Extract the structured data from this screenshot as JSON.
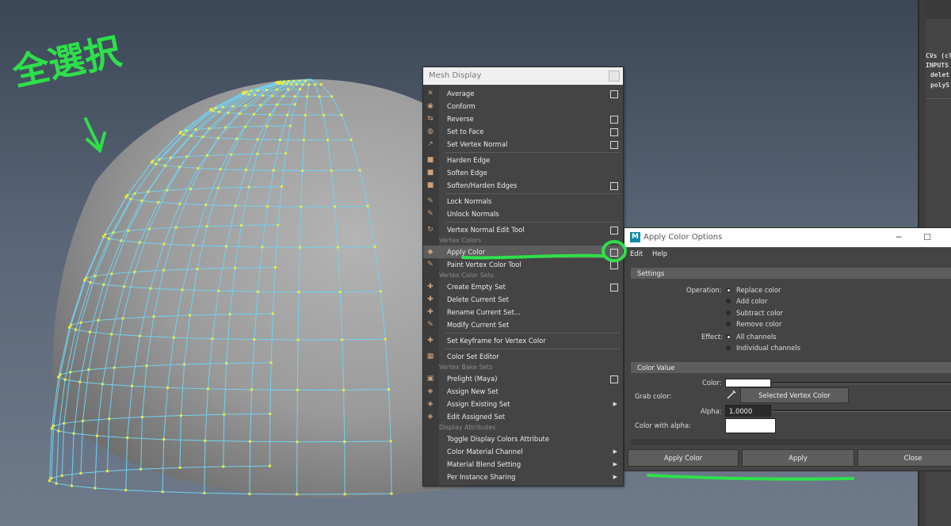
{
  "annotations": {
    "handwriting": "全選択"
  },
  "channel_box": {
    "lines": [
      "CVs (cl",
      "INPUTS",
      "delet",
      "polyS"
    ]
  },
  "mesh_display": {
    "title": "Mesh Display",
    "items": [
      {
        "type": "item",
        "label": "Average",
        "icon": "average-icon",
        "option": true
      },
      {
        "type": "item",
        "label": "Conform",
        "icon": "conform-icon",
        "option": false
      },
      {
        "type": "item",
        "label": "Reverse",
        "icon": "reverse-icon",
        "option": true
      },
      {
        "type": "item",
        "label": "Set to Face",
        "icon": "set-to-face-icon",
        "option": true
      },
      {
        "type": "item",
        "label": "Set Vertex Normal",
        "icon": "vertex-normal-icon",
        "option": true
      },
      {
        "type": "divider"
      },
      {
        "type": "item",
        "label": "Harden Edge",
        "icon": "harden-edge-icon",
        "option": false
      },
      {
        "type": "item",
        "label": "Soften Edge",
        "icon": "soften-edge-icon",
        "option": false
      },
      {
        "type": "item",
        "label": "Soften/Harden Edges",
        "icon": "soften-harden-icon",
        "option": true
      },
      {
        "type": "divider"
      },
      {
        "type": "item",
        "label": "Lock Normals",
        "icon": "lock-normals-icon",
        "option": false
      },
      {
        "type": "item",
        "label": "Unlock Normals",
        "icon": "unlock-normals-icon",
        "option": false
      },
      {
        "type": "divider"
      },
      {
        "type": "item",
        "label": "Vertex Normal Edit Tool",
        "icon": "normal-edit-tool-icon",
        "option": true
      },
      {
        "type": "section",
        "label": "Vertex Colors"
      },
      {
        "type": "item",
        "label": "Apply Color",
        "icon": "apply-color-icon",
        "option": true,
        "active": true
      },
      {
        "type": "item",
        "label": "Paint Vertex Color Tool",
        "icon": "paint-vertex-color-icon",
        "option": true
      },
      {
        "type": "section",
        "label": "Vertex Color Sets"
      },
      {
        "type": "item",
        "label": "Create Empty Set",
        "icon": "create-set-icon",
        "option": true
      },
      {
        "type": "item",
        "label": "Delete Current Set",
        "icon": "delete-set-icon",
        "option": false
      },
      {
        "type": "item",
        "label": "Rename Current Set...",
        "icon": "rename-set-icon",
        "option": false
      },
      {
        "type": "item",
        "label": "Modify Current Set",
        "icon": "modify-set-icon",
        "option": false
      },
      {
        "type": "divider"
      },
      {
        "type": "item",
        "label": "Set Keyframe for Vertex Color",
        "icon": "keyframe-icon",
        "option": false
      },
      {
        "type": "divider"
      },
      {
        "type": "item",
        "label": "Color Set Editor",
        "icon": "color-set-editor-icon",
        "option": false
      },
      {
        "type": "section",
        "label": "Vertex Bake Sets"
      },
      {
        "type": "item",
        "label": "Prelight (Maya)",
        "icon": "prelight-icon",
        "option": true
      },
      {
        "type": "item",
        "label": "Assign New Set",
        "icon": "assign-new-set-icon",
        "option": false
      },
      {
        "type": "item",
        "label": "Assign Existing Set",
        "icon": "assign-existing-set-icon",
        "submenu": true
      },
      {
        "type": "item",
        "label": "Edit Assigned Set",
        "icon": "edit-assigned-set-icon",
        "option": false
      },
      {
        "type": "section",
        "label": "Display Attributes"
      },
      {
        "type": "item",
        "label": "Toggle Display Colors Attribute",
        "icon": "",
        "option": false
      },
      {
        "type": "item",
        "label": "Color Material Channel",
        "icon": "",
        "submenu": true
      },
      {
        "type": "item",
        "label": "Material Blend Setting",
        "icon": "",
        "submenu": true
      },
      {
        "type": "item",
        "label": "Per Instance Sharing",
        "icon": "",
        "submenu": true
      }
    ]
  },
  "apply_color_options": {
    "title": "Apply Color Options",
    "app_icon_letter": "M",
    "window_buttons": {
      "minimize": "─",
      "maximize": "☐"
    },
    "menus": {
      "edit": "Edit",
      "help": "Help"
    },
    "settings_header": "Settings",
    "operation_label": "Operation:",
    "operations": [
      "Replace color",
      "Add color",
      "Subtract color",
      "Remove color"
    ],
    "operation_selected": 0,
    "effect_label": "Effect:",
    "effects": [
      "All channels",
      "Individual channels"
    ],
    "effect_selected": 0,
    "color_value_header": "Color Value",
    "color_label": "Color:",
    "grab_color_label": "Grab color:",
    "selected_vertex_color_button": "Selected Vertex Color",
    "alpha_label": "Alpha:",
    "alpha_value": "1.0000",
    "color_with_alpha_label": "Color with alpha:",
    "color_swatch": "#ffffff",
    "buttons": {
      "apply_color": "Apply Color",
      "apply": "Apply",
      "close": "Close"
    }
  }
}
